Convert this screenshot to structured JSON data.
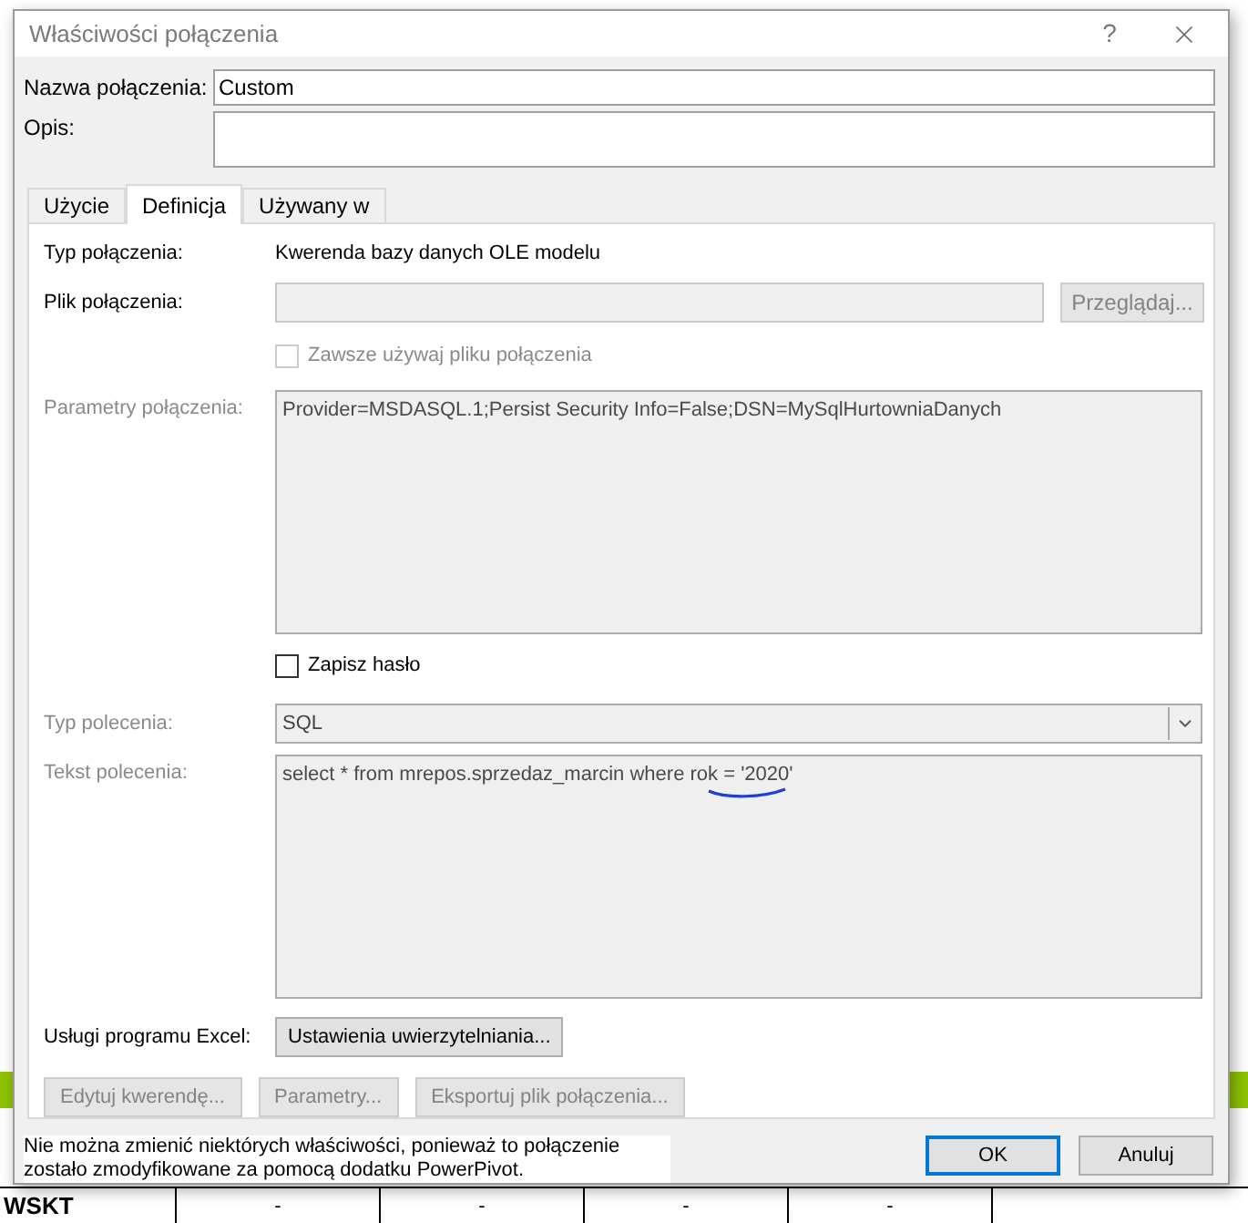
{
  "window": {
    "title": "Właściwości połączenia",
    "help": "?"
  },
  "name_field": {
    "label": "Nazwa połączenia:",
    "value": "Custom"
  },
  "description_field": {
    "label": "Opis:"
  },
  "tabs": [
    {
      "label": "Użycie",
      "selected": false
    },
    {
      "label": "Definicja",
      "selected": true
    },
    {
      "label": "Używany w",
      "selected": false
    }
  ],
  "definition": {
    "rows": [
      {
        "kind": "text",
        "label": "Typ połączenia:",
        "value": "Kwerenda bazy danych OLE modelu",
        "disabled": false
      },
      {
        "kind": "file",
        "label": "Plik połączenia:",
        "button": "Przeglądaj...",
        "button_disabled": true,
        "disabled": false
      },
      {
        "kind": "checkbox",
        "label": "Zawsze używaj pliku połączenia",
        "checked": false,
        "disabled": true
      },
      {
        "kind": "textarea",
        "label": "Parametry połączenia:",
        "value": "Provider=MSDASQL.1;Persist Security Info=False;DSN=MySqlHurtowniaDanych",
        "disabled": true
      },
      {
        "kind": "checkbox",
        "label": "Zapisz hasło",
        "checked": false,
        "disabled": false
      },
      {
        "kind": "dropdown",
        "label": "Typ polecenia:",
        "value": "SQL",
        "disabled": true
      },
      {
        "kind": "textarea",
        "label": "Tekst polecenia:",
        "value": "select * from mrepos.sprzedaz_marcin where rok = '2020'",
        "disabled": true,
        "annotated": true
      },
      {
        "kind": "button",
        "label": "Usługi programu Excel:",
        "button": "Ustawienia uwierzytelniania...",
        "disabled": false
      }
    ],
    "actions": [
      {
        "label": "Edytuj kwerendę...",
        "disabled": true
      },
      {
        "label": "Parametry...",
        "disabled": true
      },
      {
        "label": "Eksportuj plik połączenia...",
        "disabled": true
      }
    ]
  },
  "note": "Nie można zmienić niektórych właściwości, ponieważ to połączenie zostało zmodyfikowane za pomocą dodatku PowerPivot.",
  "buttons": [
    {
      "label": "OK",
      "default": true
    },
    {
      "label": "Anuluj",
      "default": false
    }
  ],
  "sheet": {
    "row_label": "WSKT",
    "cells": [
      "-",
      "-",
      "-",
      "-"
    ]
  }
}
